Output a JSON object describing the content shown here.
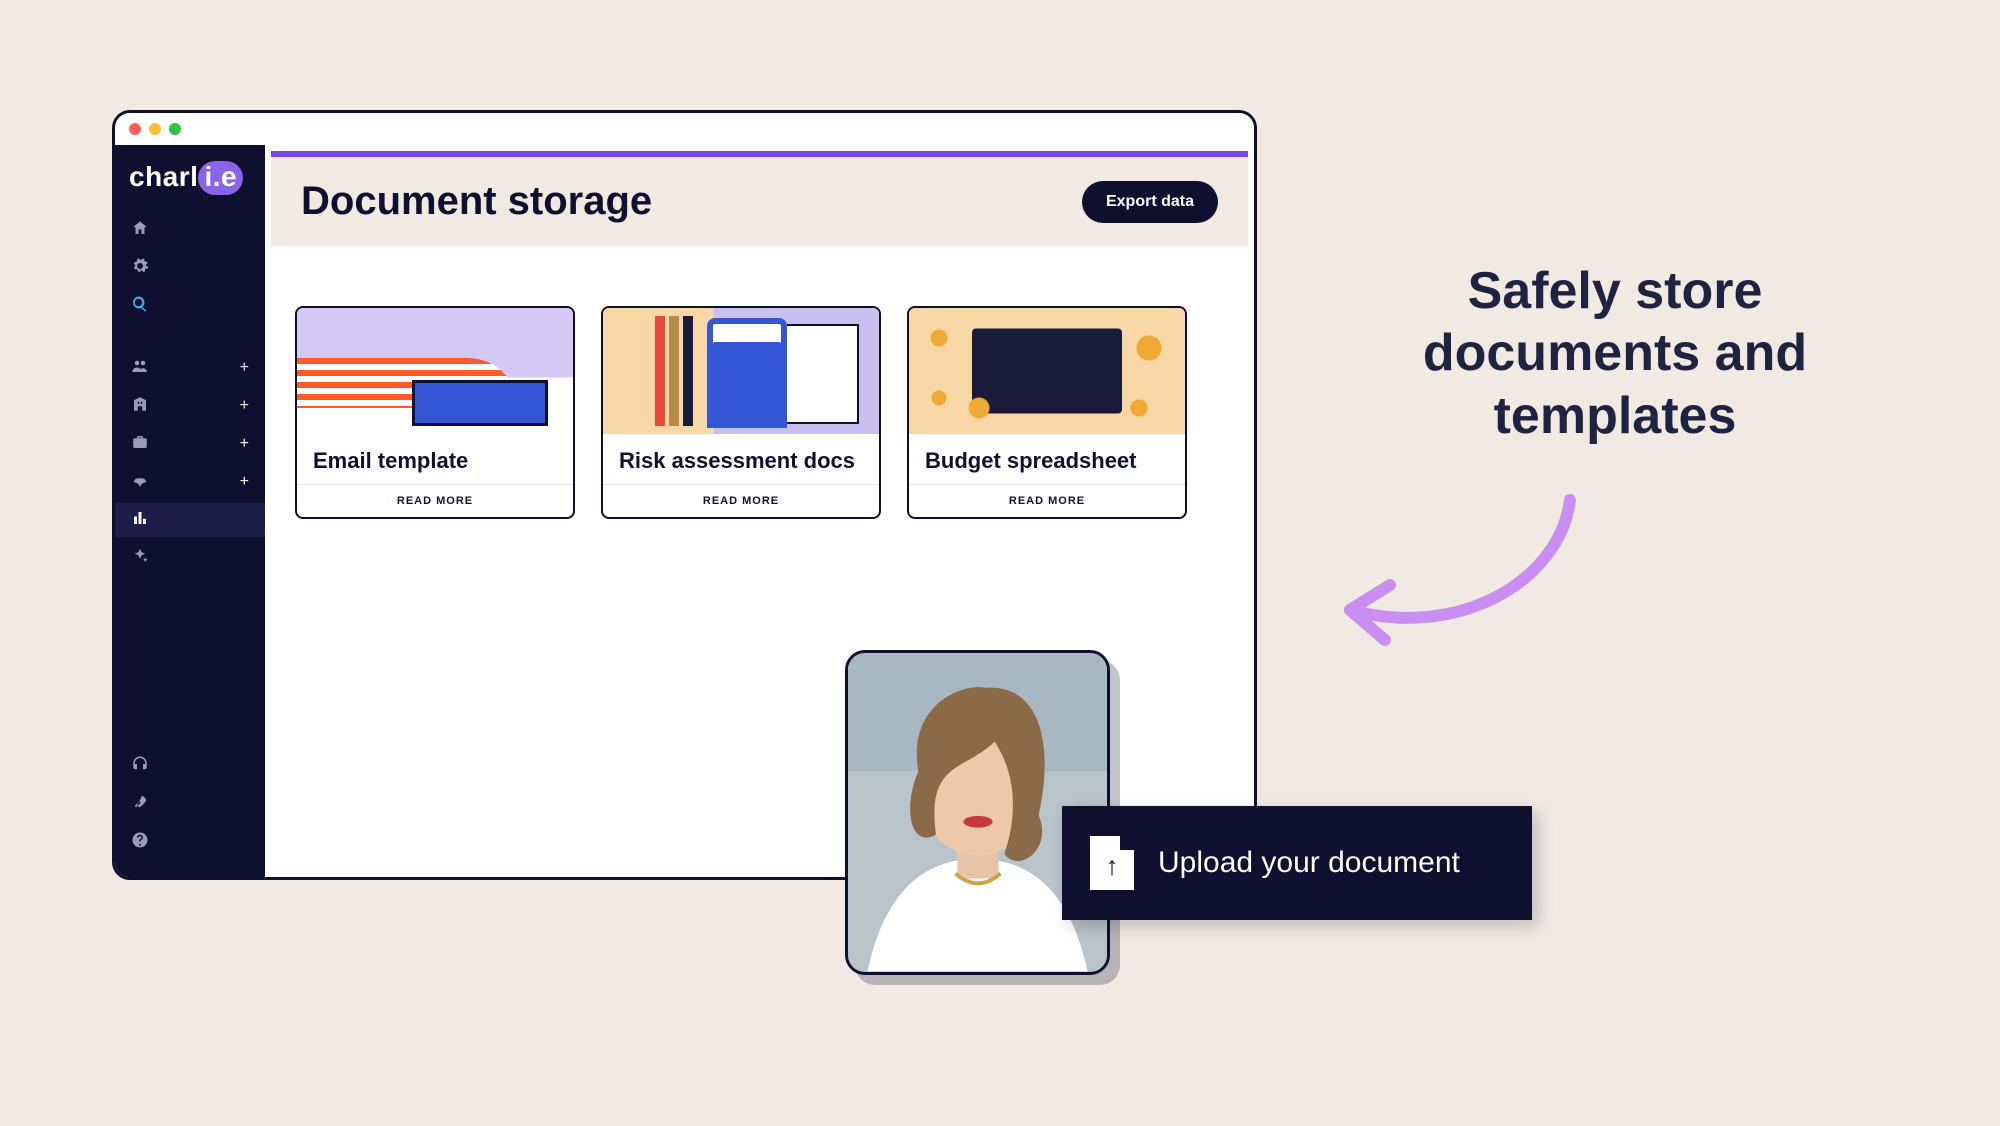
{
  "brand": {
    "prefix": "charl",
    "accent": "i.e"
  },
  "sidebar": {
    "top_icons": [
      "home-icon",
      "gear-icon",
      "search-icon"
    ],
    "items": [
      {
        "icon": "people-icon",
        "plus": true
      },
      {
        "icon": "building-icon",
        "plus": true
      },
      {
        "icon": "briefcase-icon",
        "plus": true
      },
      {
        "icon": "plant-icon",
        "plus": true
      },
      {
        "icon": "barchart-icon",
        "plus": false,
        "active": true
      },
      {
        "icon": "sparkle-icon",
        "plus": false
      }
    ],
    "bottom_icons": [
      "headset-icon",
      "rocket-icon",
      "help-icon"
    ]
  },
  "header": {
    "title": "Document storage",
    "export_label": "Export data"
  },
  "cards": [
    {
      "title": "Email template",
      "readmore": "READ MORE"
    },
    {
      "title": "Risk assessment docs",
      "readmore": "READ MORE"
    },
    {
      "title": "Budget spreadsheet",
      "readmore": "READ MORE"
    }
  ],
  "tagline": "Safely store documents and templates",
  "upload": {
    "label": "Upload your document"
  },
  "colors": {
    "accent_purple": "#8a63e6",
    "dark": "#0f1030",
    "bg": "#f0eae3",
    "arrow": "#c98ef2"
  }
}
